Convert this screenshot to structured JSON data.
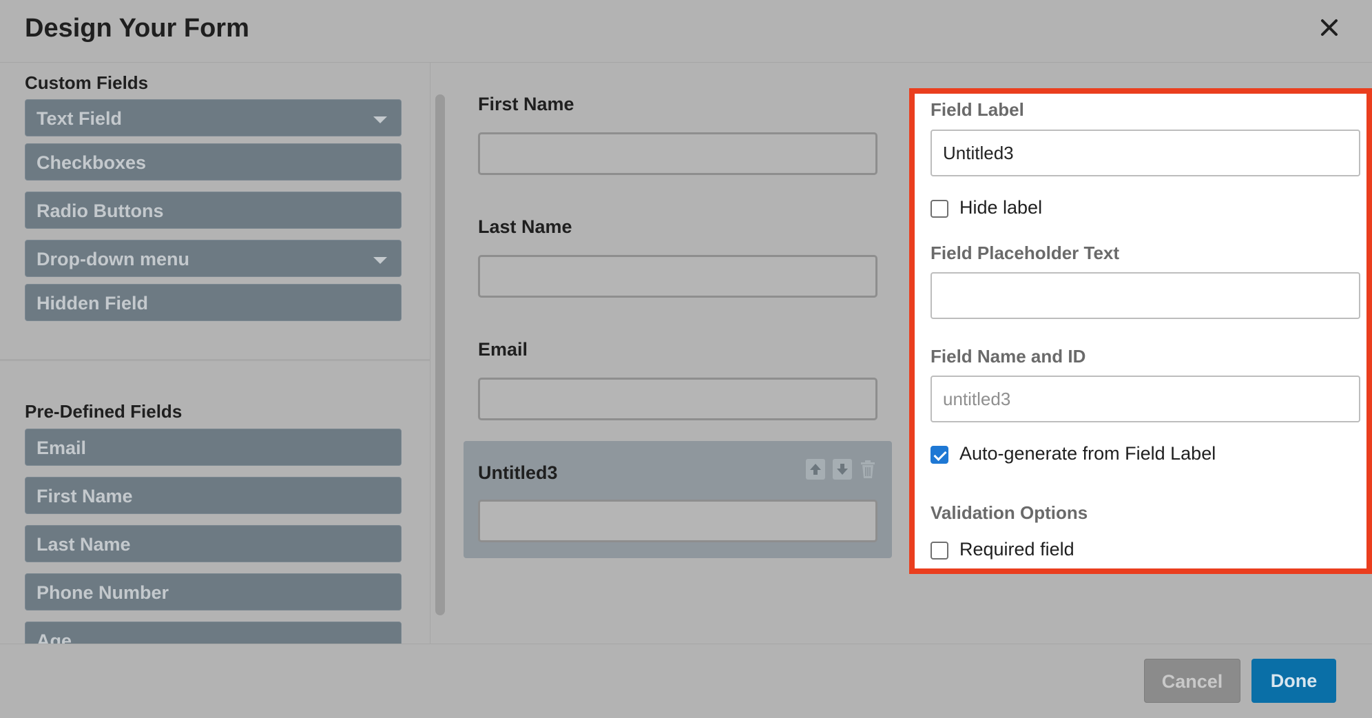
{
  "header": {
    "title": "Design Your Form",
    "close_icon": "close-icon"
  },
  "sidebar": {
    "custom_title": "Custom Fields",
    "custom_fields": [
      {
        "label": "Text Field",
        "has_caret": true
      },
      {
        "label": "Checkboxes",
        "has_caret": false
      },
      {
        "label": "Radio Buttons",
        "has_caret": false
      },
      {
        "label": "Drop-down menu",
        "has_caret": true
      },
      {
        "label": "Hidden Field",
        "has_caret": false
      }
    ],
    "predefined_title": "Pre-Defined Fields",
    "predefined_fields": [
      "Email",
      "First Name",
      "Last Name",
      "Phone Number",
      "Age"
    ]
  },
  "form": {
    "fields": [
      "First Name",
      "Last Name",
      "Email"
    ],
    "selected": {
      "label": "Untitled3",
      "tools": [
        "arrow-up-icon",
        "arrow-down-icon",
        "trash-icon"
      ]
    }
  },
  "panel": {
    "field_label_title": "Field Label",
    "field_label_value": "Untitled3",
    "hide_label": {
      "label": "Hide label",
      "checked": false
    },
    "placeholder_title": "Field Placeholder Text",
    "placeholder_value": "",
    "name_id_title": "Field Name and ID",
    "name_id_value": "untitled3",
    "auto_generate": {
      "label": "Auto-generate from Field Label",
      "checked": true
    },
    "validation_title": "Validation Options",
    "required": {
      "label": "Required field",
      "checked": false
    },
    "highlight_color": "#ea3e1e",
    "checkbox_color": "#1e78d4"
  },
  "footer": {
    "cancel_label": "Cancel",
    "done_label": "Done",
    "done_color": "#0a6fa7"
  }
}
